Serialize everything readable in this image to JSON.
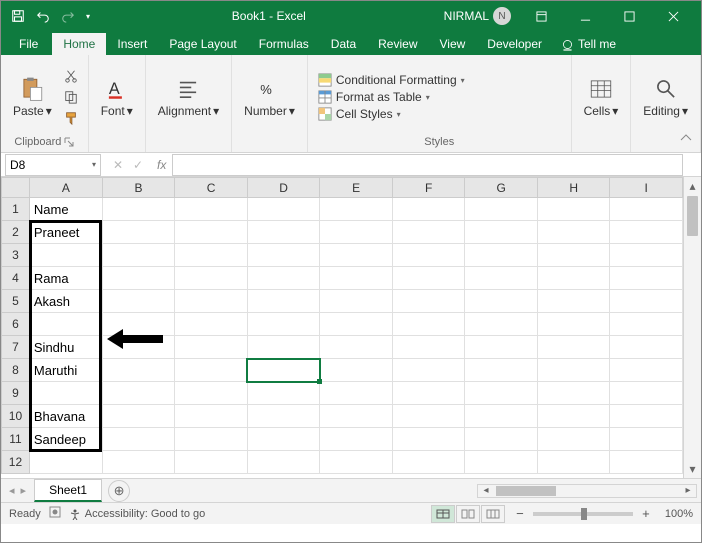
{
  "titlebar": {
    "doc_title": "Book1 - Excel",
    "user_name": "NIRMAL",
    "avatar_initial": "N"
  },
  "tabs": {
    "file": "File",
    "home": "Home",
    "insert": "Insert",
    "page_layout": "Page Layout",
    "formulas": "Formulas",
    "data": "Data",
    "review": "Review",
    "view": "View",
    "developer": "Developer",
    "tell_me": "Tell me"
  },
  "ribbon": {
    "clipboard": {
      "label": "Clipboard",
      "paste": "Paste"
    },
    "font": {
      "label": "Font"
    },
    "alignment": {
      "label": "Alignment"
    },
    "number": {
      "label": "Number"
    },
    "styles": {
      "label": "Styles",
      "cond_fmt": "Conditional Formatting",
      "fmt_table": "Format as Table",
      "cell_styles": "Cell Styles"
    },
    "cells": {
      "label": "Cells"
    },
    "editing": {
      "label": "Editing"
    }
  },
  "namebox": {
    "value": "D8"
  },
  "formula_bar": {
    "value": ""
  },
  "columns": [
    "A",
    "B",
    "C",
    "D",
    "E",
    "F",
    "G",
    "H",
    "I"
  ],
  "rows": [
    {
      "n": 1,
      "A": "Name"
    },
    {
      "n": 2,
      "A": "Praneet"
    },
    {
      "n": 3,
      "A": ""
    },
    {
      "n": 4,
      "A": "Rama"
    },
    {
      "n": 5,
      "A": "Akash"
    },
    {
      "n": 6,
      "A": ""
    },
    {
      "n": 7,
      "A": "Sindhu"
    },
    {
      "n": 8,
      "A": "Maruthi"
    },
    {
      "n": 9,
      "A": ""
    },
    {
      "n": 10,
      "A": "Bhavana"
    },
    {
      "n": 11,
      "A": "Sandeep"
    },
    {
      "n": 12,
      "A": ""
    }
  ],
  "selected_cell": "D8",
  "sheet_tab": {
    "name": "Sheet1"
  },
  "statusbar": {
    "ready": "Ready",
    "accessibility": "Accessibility: Good to go",
    "zoom": "100%"
  }
}
